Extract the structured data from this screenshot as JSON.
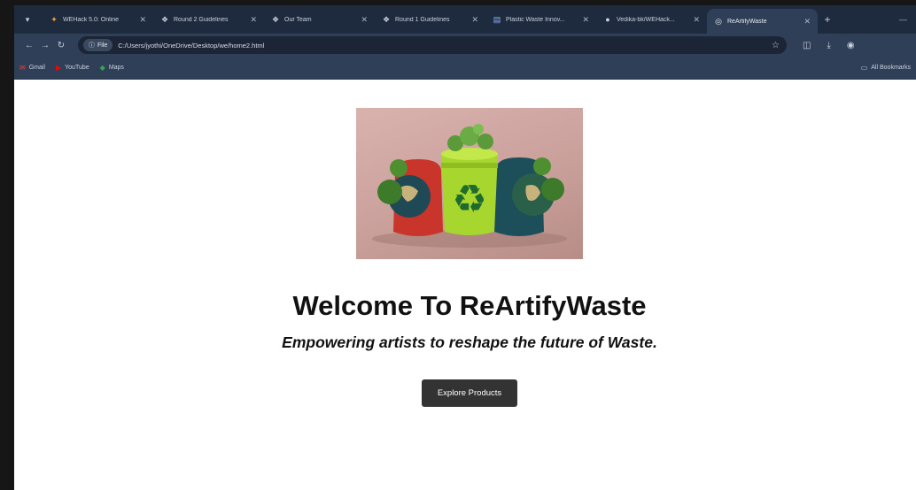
{
  "browser": {
    "tabs": [
      {
        "title": "WEHack 5.0: Online",
        "icon": "wehack-favicon"
      },
      {
        "title": "Round 2 Guidelines",
        "icon": "devfolio-favicon"
      },
      {
        "title": "Our Team",
        "icon": "devfolio-favicon"
      },
      {
        "title": "Round 1 Guidelines",
        "icon": "devfolio-favicon"
      },
      {
        "title": "Plastic Waste Innov...",
        "icon": "doc-favicon"
      },
      {
        "title": "Vedika-bk/WEHack...",
        "icon": "github-favicon"
      },
      {
        "title": "ReArtifyWaste",
        "icon": "globe-favicon",
        "active": true
      }
    ],
    "address": {
      "chip_label": "File",
      "url": "C:/Users/jyothi/OneDrive/Desktop/we/home2.html"
    },
    "bookmarks": [
      {
        "label": "Gmail",
        "icon": "gmail-icon"
      },
      {
        "label": "YouTube",
        "icon": "youtube-icon"
      },
      {
        "label": "Maps",
        "icon": "maps-icon"
      }
    ],
    "all_bookmarks_label": "All Bookmarks"
  },
  "page": {
    "title": "Welcome To ReArtifyWaste",
    "subtitle": "Empowering artists to reshape the future of Waste.",
    "cta_label": "Explore Products"
  },
  "colors": {
    "tab_strip_bg": "#1e2a3d",
    "toolbar_bg": "#2f3f57",
    "button_bg": "#333333",
    "recycle_green": "#a7d62e"
  }
}
